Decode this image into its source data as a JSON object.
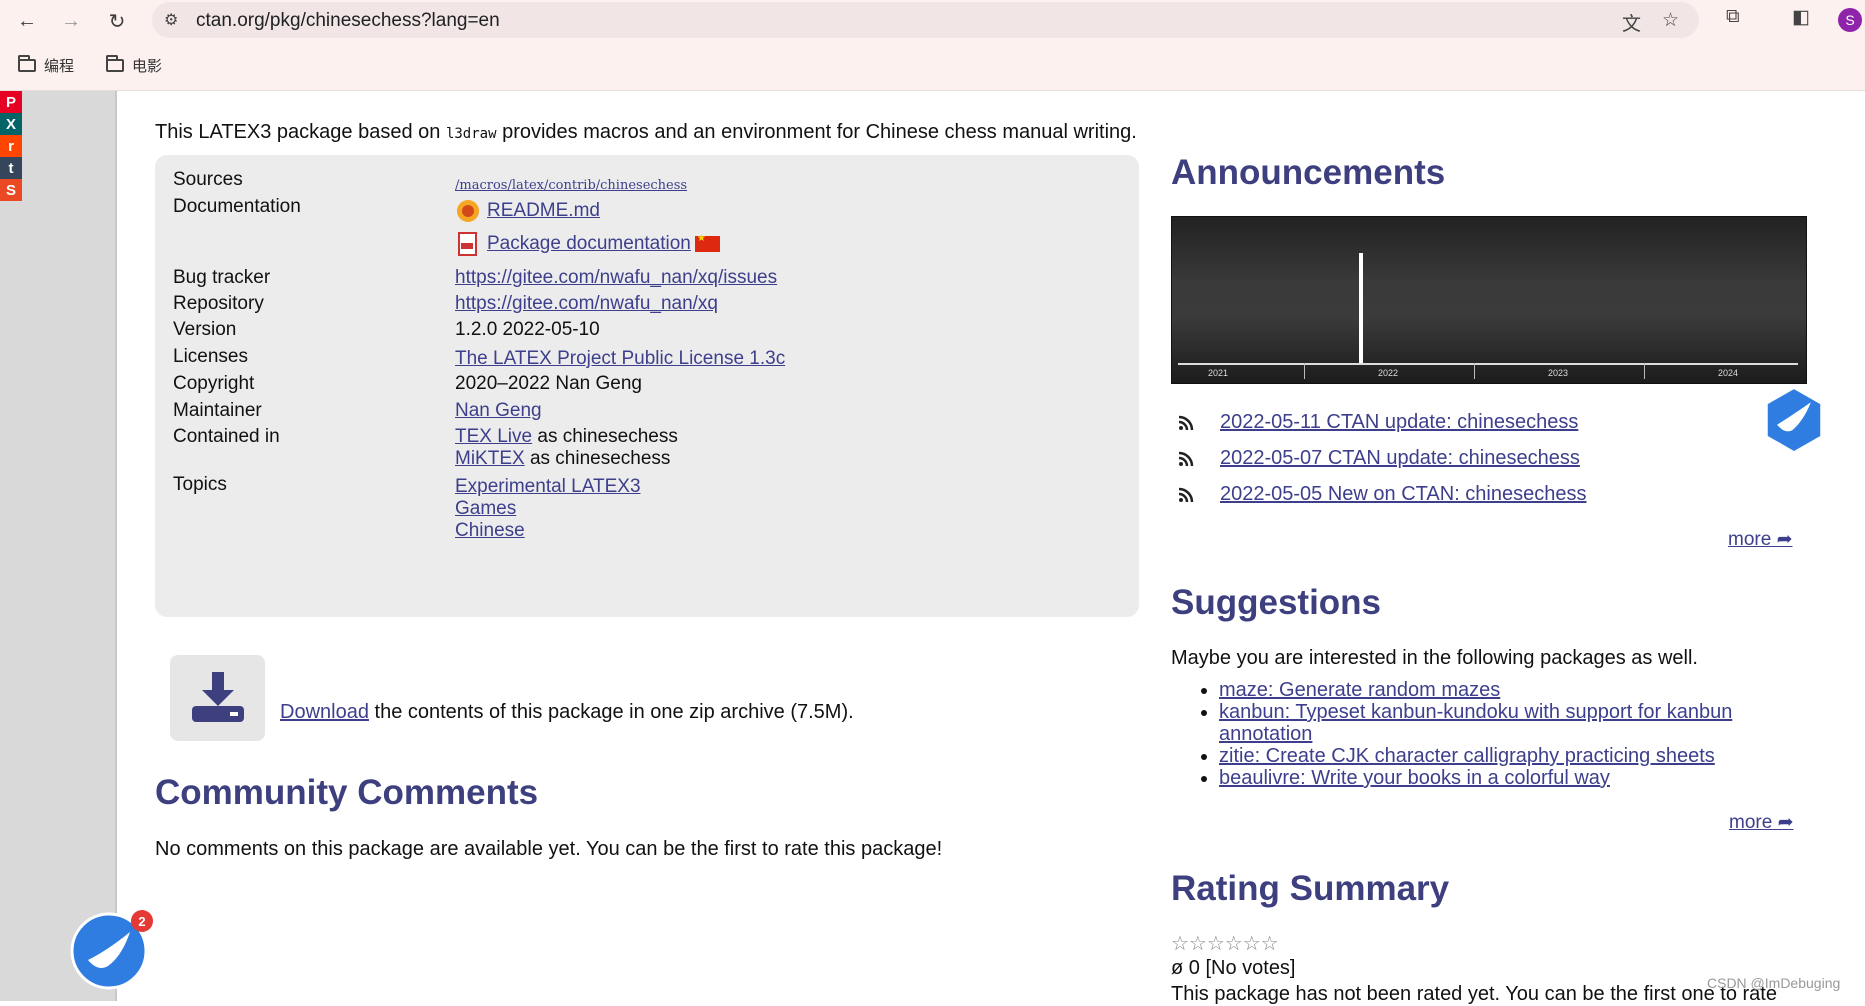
{
  "browser": {
    "url": "ctan.org/pkg/chinesechess?lang=en",
    "bookmarks": [
      "编程",
      "电影"
    ],
    "profile_initial": "S"
  },
  "share": [
    "P",
    "X",
    "r",
    "t",
    "S"
  ],
  "intro": {
    "before": "This ",
    "latex": "LATEX3",
    "middle": " package based on ",
    "code": "l3draw",
    "after": " provides macros and an environment for Chinese chess manual writing."
  },
  "info": {
    "sources_label": "Sources",
    "sources_value": "/macros/latex/contrib/chinesechess",
    "documentation_label": "Documentation",
    "doc_readme": "README.md",
    "doc_package": "Package documentation",
    "bugtracker_label": "Bug tracker",
    "bugtracker_value": "https://gitee.com/nwafu_nan/xq/issues",
    "repository_label": "Repository",
    "repository_value": "https://gitee.com/nwafu_nan/xq",
    "version_label": "Version",
    "version_value": "1.2.0 2022-05-10",
    "licenses_label": "Licenses",
    "licenses_value": "The LATEX Project Public License 1.3c",
    "copyright_label": "Copyright",
    "copyright_value": "2020–2022 Nan Geng",
    "maintainer_label": "Maintainer",
    "maintainer_value": "Nan Geng",
    "contained_label": "Contained in",
    "contained_texlive": "TEX Live",
    "contained_texlive_suffix": " as chinesechess",
    "contained_miktex": "MiKTEX",
    "contained_miktex_suffix": " as chinesechess",
    "topics_label": "Topics",
    "topics": [
      "Experimental LATEX3",
      "Games",
      "Chinese"
    ]
  },
  "download": {
    "link": "Download",
    "text": " the contents of this package in one zip archive (7.5M)."
  },
  "community": {
    "title": "Community Comments",
    "text": "No comments on this package are available yet. You can be the first to rate this package!"
  },
  "announcements": {
    "title": "Announcements",
    "timeline_years": [
      "2021",
      "2022",
      "2023",
      "2024"
    ],
    "items": [
      "2022-05-11 CTAN update: chinesechess",
      "2022-05-07 CTAN update: chinesechess",
      "2022-05-05 New on CTAN: chinesechess"
    ],
    "more": "more"
  },
  "suggestions": {
    "title": "Suggestions",
    "intro": "Maybe you are interested in the following packages as well.",
    "items": [
      "maze: Generate random mazes",
      "kanbun: Typeset kanbun-kundoku with support for kanbun annotation",
      "zitie: Create CJK character calligraphy practicing sheets",
      "beaulivre: Write your books in a colorful way"
    ],
    "more": "more"
  },
  "rating": {
    "title": "Rating Summary",
    "stars": "☆☆☆☆☆☆",
    "value": "ø 0 [No votes]",
    "cutoff_text": "This package has not been rated yet. You can be the first one to rate"
  },
  "notification_count": "2",
  "watermark": "CSDN @ImDebuging"
}
